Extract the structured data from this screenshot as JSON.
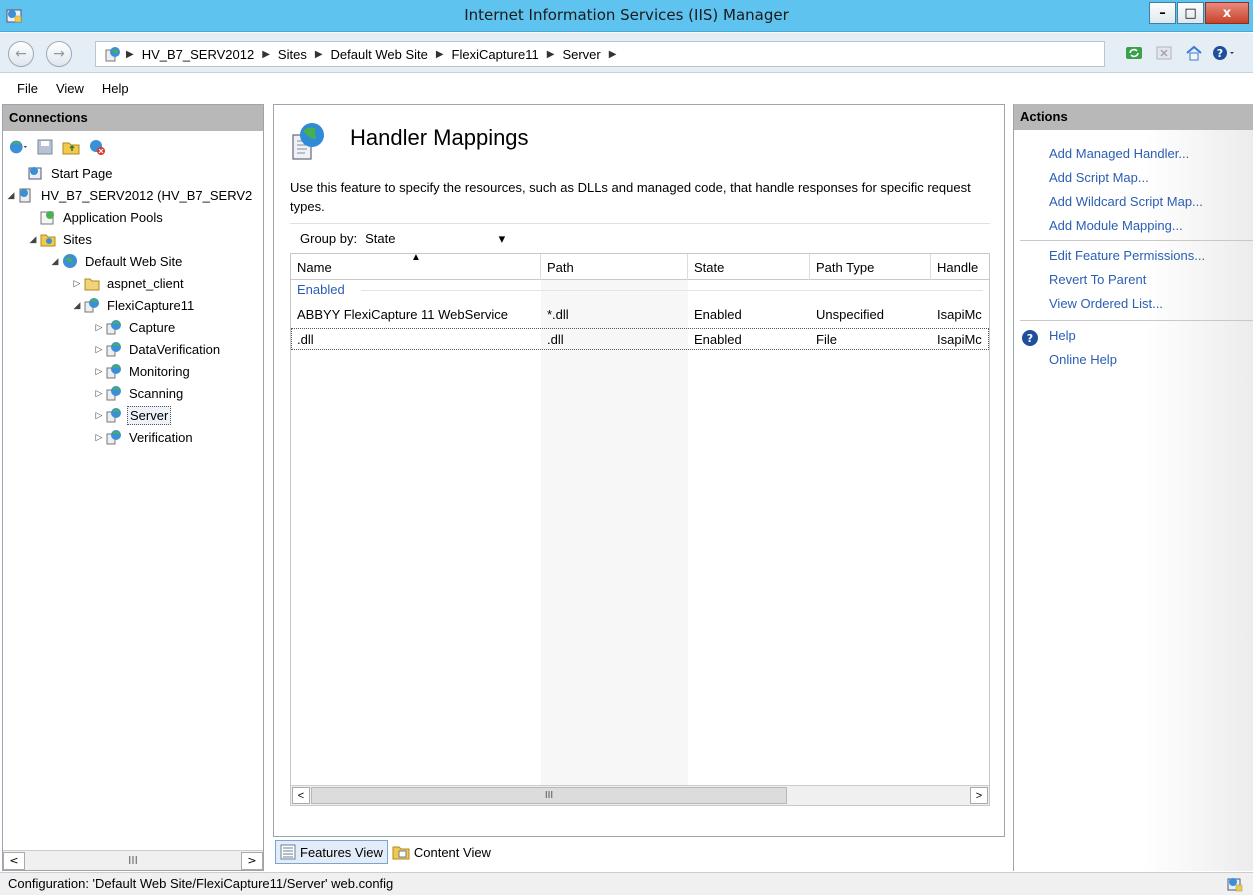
{
  "window": {
    "title": "Internet Information Services (IIS) Manager",
    "min_label": "–",
    "max_label": "□",
    "close_label": "x"
  },
  "address": {
    "crumbs": [
      "HV_B7_SERV2012",
      "Sites",
      "Default Web Site",
      "FlexiCapture11",
      "Server"
    ],
    "separator": "▶"
  },
  "menu": [
    "File",
    "View",
    "Help"
  ],
  "connections": {
    "header": "Connections",
    "tree": [
      {
        "label": "Start Page",
        "icon": "start-page-icon",
        "expand": ""
      },
      {
        "label": "HV_B7_SERV2012 (HV_B7_SERV2",
        "icon": "server-icon",
        "expand": "◢"
      },
      {
        "label": "Application Pools",
        "icon": "app-pools-icon",
        "expand": ""
      },
      {
        "label": "Sites",
        "icon": "sites-folder-icon",
        "expand": "◢"
      },
      {
        "label": "Default Web Site",
        "icon": "globe-icon",
        "expand": "◢"
      },
      {
        "label": "aspnet_client",
        "icon": "folder-icon",
        "expand": "▷"
      },
      {
        "label": "FlexiCapture11",
        "icon": "app-icon",
        "expand": "◢"
      },
      {
        "label": "Capture",
        "icon": "app-icon",
        "expand": "▷"
      },
      {
        "label": "DataVerification",
        "icon": "app-icon",
        "expand": "▷"
      },
      {
        "label": "Monitoring",
        "icon": "app-icon",
        "expand": "▷"
      },
      {
        "label": "Scanning",
        "icon": "app-icon",
        "expand": "▷"
      },
      {
        "label": "Server",
        "icon": "app-icon",
        "expand": "▷",
        "selected": true
      },
      {
        "label": "Verification",
        "icon": "app-icon",
        "expand": "▷"
      }
    ],
    "scroll_grip": "III"
  },
  "feature": {
    "title": "Handler Mappings",
    "description": "Use this feature to specify the resources, such as DLLs and managed code, that handle responses for specific request types.",
    "group_by_label": "Group by:",
    "group_by_value": "State",
    "columns": [
      "Name",
      "Path",
      "State",
      "Path Type",
      "Handle"
    ],
    "group": "Enabled",
    "rows": [
      {
        "name": "ABBYY FlexiCapture 11 WebService",
        "path": "*.dll",
        "state": "Enabled",
        "path_type": "Unspecified",
        "handler": "IsapiMc"
      },
      {
        "name": ".dll",
        "path": ".dll",
        "state": "Enabled",
        "path_type": "File",
        "handler": "IsapiMc"
      }
    ],
    "scroll_grip": "III"
  },
  "view_tabs": [
    "Features View",
    "Content View"
  ],
  "actions": {
    "header": "Actions",
    "group1": [
      "Add Managed Handler...",
      "Add Script Map...",
      "Add Wildcard Script Map...",
      "Add Module Mapping..."
    ],
    "group2": [
      "Edit Feature Permissions...",
      "Revert To Parent",
      "View Ordered List..."
    ],
    "help": "Help",
    "online_help": "Online Help"
  },
  "status": {
    "text": "Configuration: 'Default Web Site/FlexiCapture11/Server' web.config"
  },
  "colors": {
    "titlebar": "#5fc3f0",
    "link": "#2b5eb3",
    "pane_header": "#b8b8b8"
  }
}
